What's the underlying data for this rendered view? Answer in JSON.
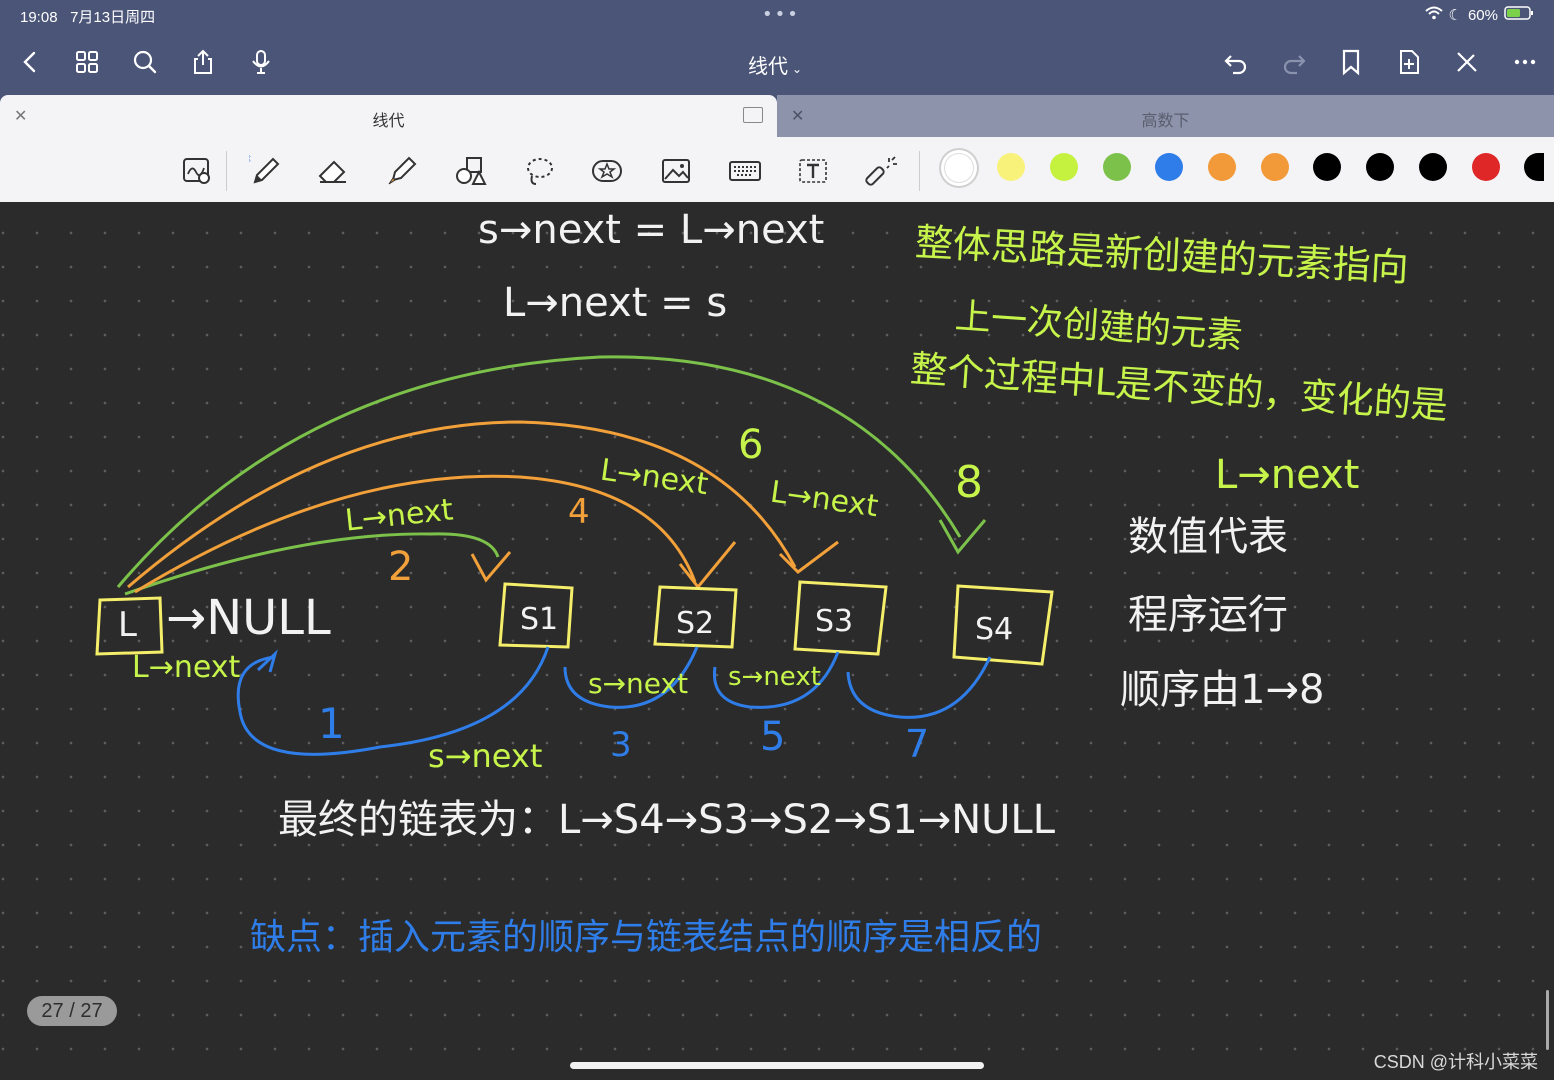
{
  "status": {
    "time": "19:08",
    "date": "7月13日周四",
    "battery": "60%"
  },
  "document": {
    "title": "线代"
  },
  "tabs": [
    {
      "label": "线代",
      "active": true
    },
    {
      "label": "高数下",
      "active": false
    }
  ],
  "tools": [
    "zoom-icon",
    "pen-icon",
    "eraser-icon",
    "highlighter-icon",
    "shapes-icon",
    "lasso-icon",
    "sticker-icon",
    "image-icon",
    "keyboard-icon",
    "text-icon",
    "laser-icon"
  ],
  "colors": [
    "#ffffff",
    "#f8f27a",
    "#c5f23f",
    "#7cc24a",
    "#2f7de8",
    "#f29a3a",
    "#f29a3a",
    "#000000",
    "#000000",
    "#000000",
    "#e02727",
    "#000000"
  ],
  "note": {
    "line1": "s→next = L→next",
    "line2": "L→next = s",
    "green_title1": "整体思路是新创建的元素指向",
    "green_title2": "上一次创建的元素",
    "green_title3": "整个过程中L是不变的，变化的是",
    "green_title4": "L→next",
    "white_list1": "数值代表",
    "white_list2": "程序运行",
    "white_list3": "顺序由1→8",
    "node_L": "L",
    "null_text": "→NULL",
    "nodes": [
      "S1",
      "S2",
      "S3",
      "S4"
    ],
    "label_Lnext_bottom": "L→next",
    "label_Lnext_2": "L→next",
    "label_Lnext_4": "L→next",
    "label_Lnext_6": "L→next",
    "num_2": "2",
    "num_4": "4",
    "num_6": "6",
    "num_8": "8",
    "label_snext_1": "s→next",
    "label_snext_3": "s→next",
    "label_snext_5": "s→next",
    "num_1": "1",
    "num_3": "3",
    "num_5": "5",
    "num_7": "7",
    "final": "最终的链表为：L→S4→S3→S2→S1→NULL",
    "drawback": "缺点：插入元素的顺序与链表结点的顺序是相反的"
  },
  "page": {
    "indicator": "27 / 27"
  },
  "watermark": "CSDN @计科小菜菜"
}
